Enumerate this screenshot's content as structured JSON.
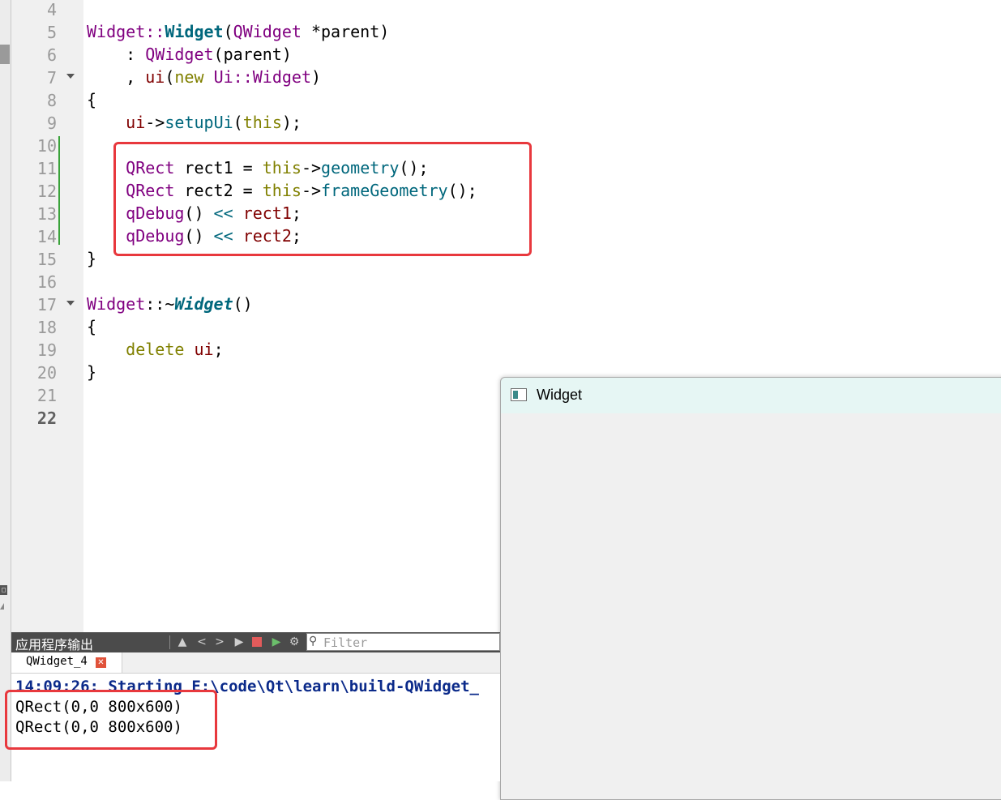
{
  "editor": {
    "line_numbers": [
      "4",
      "5",
      "6",
      "7",
      "8",
      "9",
      "10",
      "11",
      "12",
      "13",
      "14",
      "15",
      "16",
      "17",
      "18",
      "19",
      "20",
      "21",
      "22"
    ],
    "code": {
      "l5": {
        "a": "Widget",
        "b": "::",
        "c": "Widget",
        "d": "(",
        "e": "QWidget",
        "f": " *parent)"
      },
      "l6": {
        "a": "    : ",
        "b": "QWidget",
        "c": "(parent)"
      },
      "l7": {
        "a": "    , ",
        "b": "ui",
        "c": "(",
        "d": "new",
        "e": " ",
        "f": "Ui",
        "g": "::",
        "h": "Widget",
        "i": ")"
      },
      "l8": "{",
      "l9": {
        "a": "    ",
        "b": "ui",
        "c": "->",
        "d": "setupUi",
        "e": "(",
        "f": "this",
        "g": ");"
      },
      "l11": {
        "a": "    ",
        "b": "QRect",
        "c": " rect1 = ",
        "d": "this",
        "e": "->",
        "f": "geometry",
        "g": "();"
      },
      "l12": {
        "a": "    ",
        "b": "QRect",
        "c": " rect2 = ",
        "d": "this",
        "e": "->",
        "f": "frameGeometry",
        "g": "();"
      },
      "l13": {
        "a": "    ",
        "b": "qDebug",
        "c": "() ",
        "d": "<<",
        "e": " ",
        "f": "rect1",
        "g": ";"
      },
      "l14": {
        "a": "    ",
        "b": "qDebug",
        "c": "() ",
        "d": "<<",
        "e": " ",
        "f": "rect2",
        "g": ";"
      },
      "l15": "}",
      "l17": {
        "a": "Widget",
        "b": "::~",
        "c": "Widget",
        "d": "()"
      },
      "l18": "{",
      "l19": {
        "a": "    ",
        "b": "delete",
        "c": " ",
        "d": "ui",
        "e": ";"
      },
      "l20": "}"
    }
  },
  "widget_window": {
    "title": "Widget"
  },
  "output_pane": {
    "title": "应用程序输出",
    "filter_placeholder": "Filter",
    "tab_label": "QWidget_4",
    "lines": [
      "14:09:26: Starting E:\\code\\Qt\\learn\\build-QWidget_",
      "QRect(0,0 800x600)",
      "QRect(0,0 800x600)"
    ]
  },
  "colors": {
    "highlight_box": "#e8383d",
    "type_purple": "#800080",
    "keyword_olive": "#808000",
    "function_teal": "#00677c"
  }
}
